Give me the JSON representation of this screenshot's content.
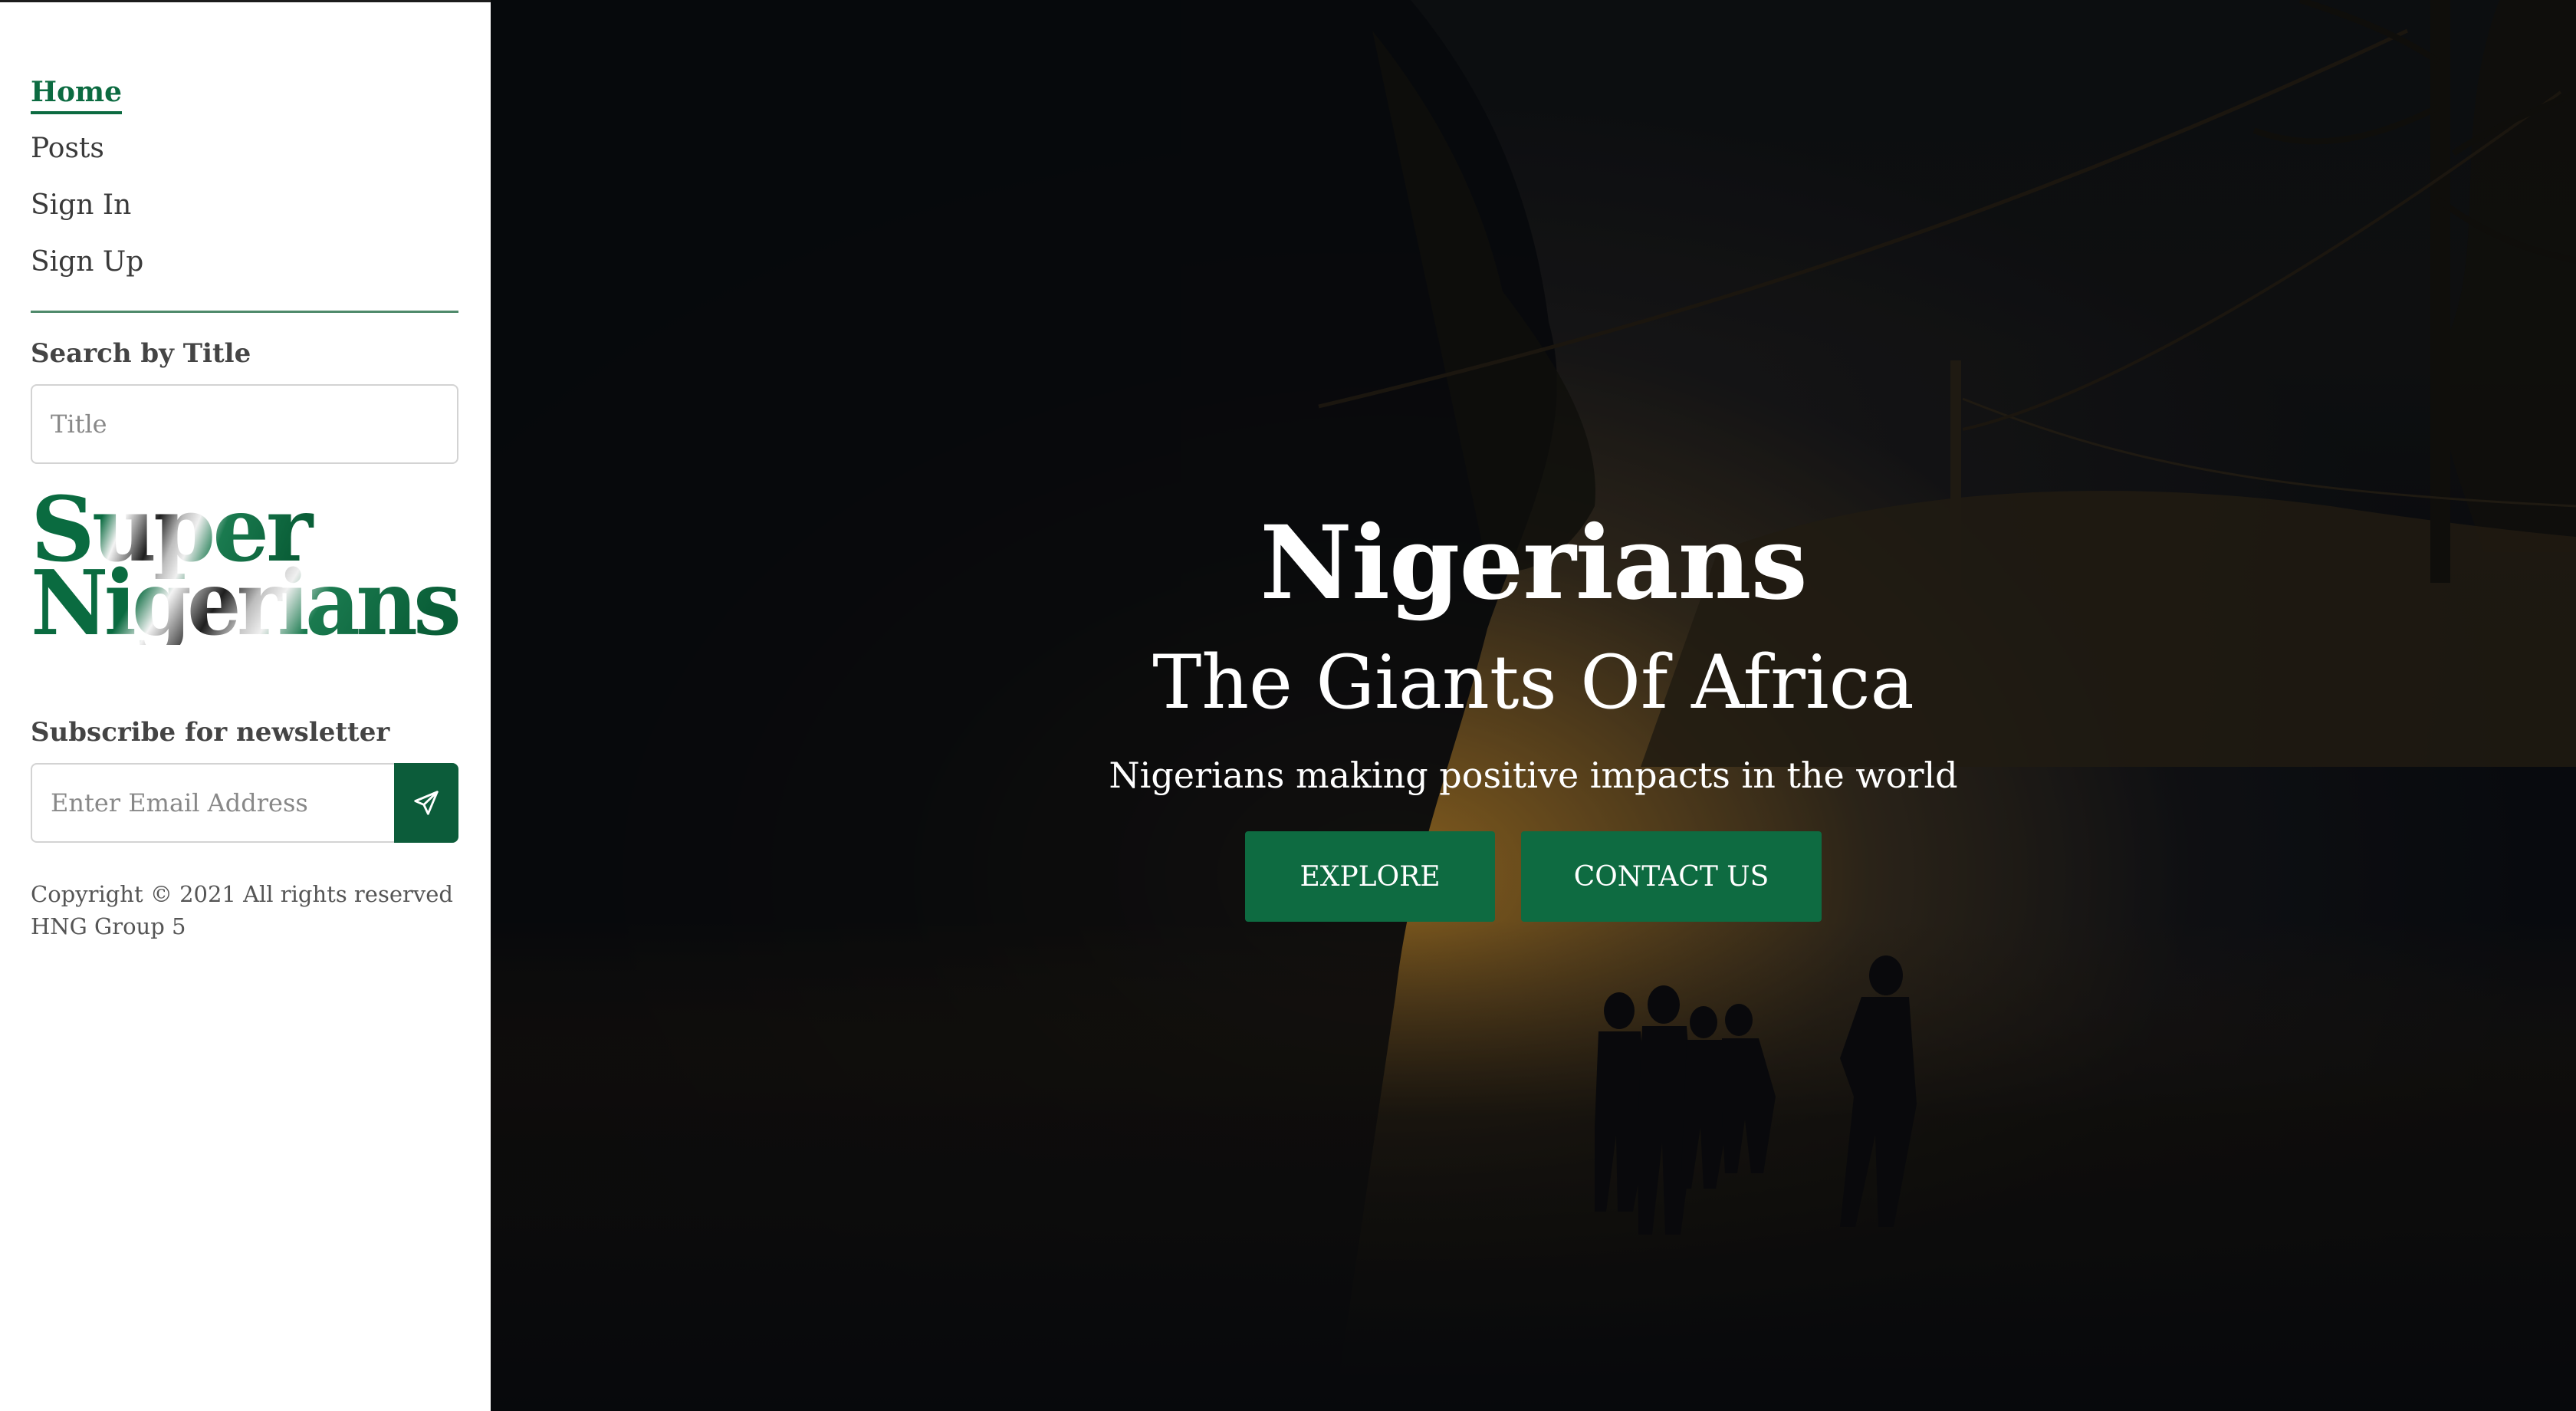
{
  "nav": {
    "items": [
      {
        "label": "Home",
        "active": true
      },
      {
        "label": "Posts"
      },
      {
        "label": "Sign In"
      },
      {
        "label": "Sign Up"
      }
    ]
  },
  "search": {
    "label": "Search by Title",
    "placeholder": "Title"
  },
  "logo": {
    "line1": "Super",
    "line2": "Nigerians",
    "colors": [
      "#0c6b41",
      "#ffffff",
      "#1e1e1e"
    ]
  },
  "newsletter": {
    "label": "Subscribe for newsletter",
    "placeholder": "Enter Email Address",
    "send_icon": "paper-plane-icon"
  },
  "footer": {
    "copyright": "Copyright © 2021 All rights reserved HNG Group 5"
  },
  "hero": {
    "title": "Nigerians",
    "subtitle": "The Giants Of Africa",
    "tagline": "Nigerians making positive impacts in the world",
    "explore_label": "EXPLORE",
    "contact_label": "CONTACT US"
  },
  "colors": {
    "accent": "#0e6b41",
    "divider": "#4f8a6b"
  }
}
